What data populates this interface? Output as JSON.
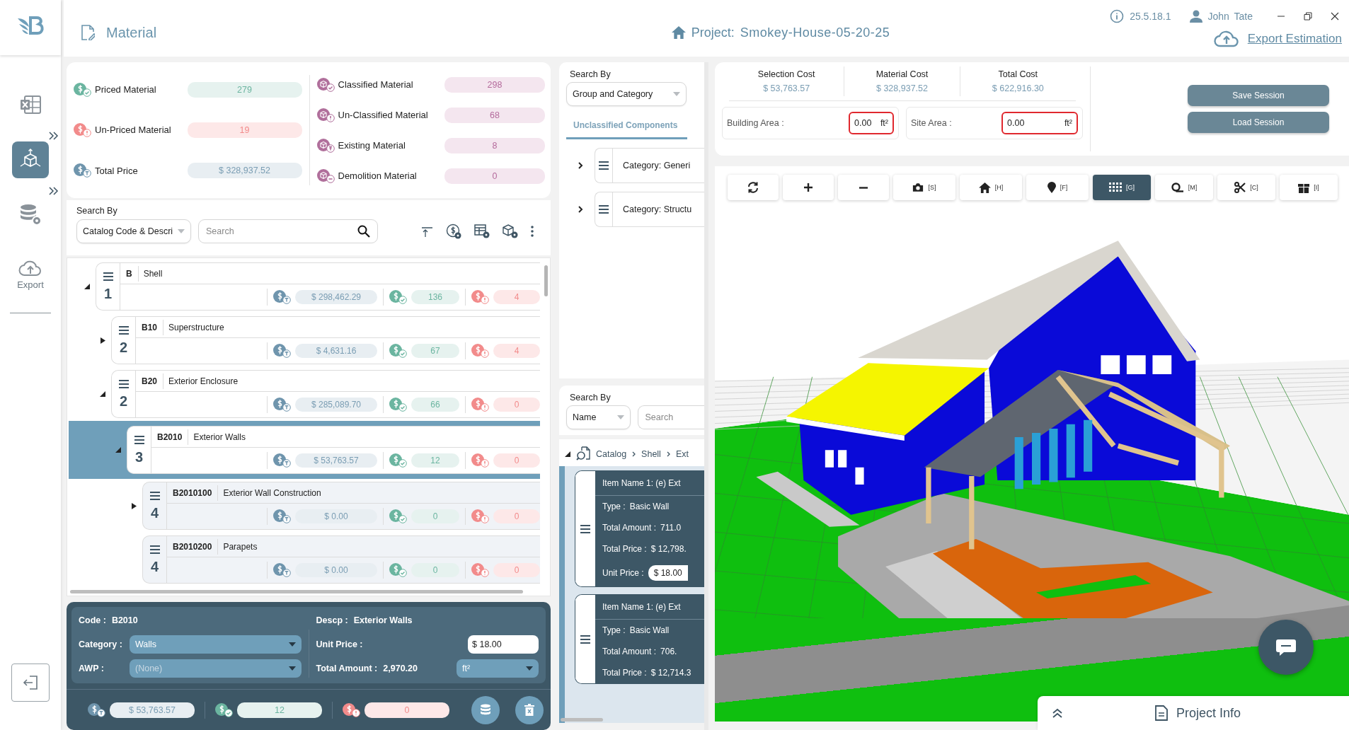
{
  "sidebar": {
    "items": [
      {
        "kind": "spreadsheet",
        "selected": false,
        "has_submenu": false
      },
      {
        "kind": "model",
        "selected": true,
        "has_submenu": true
      },
      {
        "kind": "database",
        "selected": false,
        "has_submenu": true
      },
      {
        "kind": "export",
        "selected": false,
        "has_submenu": false,
        "label": "Export"
      },
      {
        "kind": "logout",
        "selected": false,
        "has_submenu": false
      }
    ]
  },
  "header": {
    "title": "Material",
    "project_label": "Project:",
    "project_name": "Smokey-House-05-20-25",
    "version": "25.5.18.1",
    "user": "John Tate",
    "export": "Export Estimation"
  },
  "summary": {
    "left": [
      {
        "kind": "priced",
        "label": "Priced Material",
        "value": "279"
      },
      {
        "kind": "unpriced",
        "label": "Un-Priced Material",
        "value": "19"
      },
      {
        "kind": "total",
        "label": "Total Price",
        "value": "$ 328,937.52"
      }
    ],
    "right": [
      {
        "kind": "classified",
        "label": "Classified Material",
        "value": "298"
      },
      {
        "kind": "unclassified",
        "label": "Un-Classified Material",
        "value": "68"
      },
      {
        "kind": "existing",
        "label": "Existing Material",
        "value": "8"
      },
      {
        "kind": "demolition",
        "label": "Demolition Material",
        "value": "0"
      }
    ]
  },
  "search": {
    "label": "Search By",
    "by": "Catalog Code & Descri",
    "placeholder": "Search"
  },
  "tree": [
    {
      "code": "B",
      "name": "Shell",
      "level": "1",
      "expanded": true,
      "selected": false,
      "total": "$ 298,462.29",
      "priced": "136",
      "unpriced": "4",
      "children": [
        {
          "code": "B10",
          "name": "Superstructure",
          "level": "2",
          "expanded": false,
          "selected": false,
          "total": "$ 4,631.16",
          "priced": "67",
          "unpriced": "4"
        },
        {
          "code": "B20",
          "name": "Exterior Enclosure",
          "level": "2",
          "expanded": true,
          "selected": false,
          "total": "$ 285,089.70",
          "priced": "66",
          "unpriced": "0",
          "children": [
            {
              "code": "B2010",
              "name": "Exterior Walls",
              "level": "3",
              "expanded": true,
              "selected": true,
              "total": "$ 53,763.57",
              "priced": "12",
              "unpriced": "0",
              "children": [
                {
                  "code": "B2010100",
                  "name": "Exterior Wall Construction",
                  "level": "4",
                  "expanded": false,
                  "selected": false,
                  "total": "$ 0.00",
                  "priced": "0",
                  "unpriced": "0"
                },
                {
                  "code": "B2010200",
                  "name": "Parapets",
                  "level": "4",
                  "selected": false,
                  "total": "$ 0.00",
                  "priced": "0",
                  "unpriced": "0"
                }
              ]
            }
          ]
        }
      ]
    }
  ],
  "detail": {
    "code_label": "Code :",
    "code": "B2010",
    "descp_label": "Descp :",
    "descp": "Exterior Walls",
    "category_label": "Category :",
    "category": "Walls",
    "awp_label": "AWP :",
    "awp": "(None)",
    "unit_price_label": "Unit Price :",
    "unit_price": "$ 18.00",
    "total_amount_label": "Total Amount :",
    "total_amount": "2,970.20",
    "unit": "ft²",
    "total": "$ 53,763.57",
    "priced": "12",
    "unpriced": "0"
  },
  "middle": {
    "search_label": "Search By",
    "search_by": "Group and Category",
    "tab": {
      "label": "Unclassified Components",
      "selected": true
    },
    "categories": [
      {
        "label": "Category:",
        "value": "Generi"
      },
      {
        "label": "Category:",
        "value": "Structu"
      }
    ],
    "lower": {
      "search_label": "Search By",
      "search_by": "Name",
      "placeholder": "Search",
      "breadcrumb": [
        "Catalog",
        "Shell",
        "Ext"
      ],
      "items": [
        {
          "name": "Item Name 1: (e) Ext",
          "fields": [
            {
              "kind": "text",
              "label": "Type :",
              "value": "Basic Wall"
            },
            {
              "kind": "text",
              "label": "Total Amount :",
              "value": "711.0"
            },
            {
              "kind": "text",
              "label": "Total Price :",
              "value": "$ 12,798."
            },
            {
              "kind": "input",
              "label": "Unit Price :",
              "value": "$ 18.00"
            }
          ]
        },
        {
          "name": "Item Name 1: (e) Ext",
          "fields": [
            {
              "kind": "text",
              "label": "Type :",
              "value": "Basic Wall"
            },
            {
              "kind": "text",
              "label": "Total Amount :",
              "value": "706."
            },
            {
              "kind": "text",
              "label": "Total Price :",
              "value": "$ 12,714.3"
            }
          ]
        }
      ]
    }
  },
  "costs": [
    {
      "label": "Selection Cost",
      "value": "$ 53,763.57"
    },
    {
      "label": "Material Cost",
      "value": "$ 328,937.52"
    },
    {
      "label": "Total Cost",
      "value": "$ 622,916.30"
    }
  ],
  "areas": [
    {
      "label": "Building Area :",
      "value": "0.00",
      "unit": "ft²"
    },
    {
      "label": "Site Area :",
      "value": "0.00",
      "unit": "ft²"
    }
  ],
  "session_buttons": [
    "Save Session",
    "Load Session"
  ],
  "viewer": {
    "tools": [
      {
        "kind": "refresh",
        "selected": false
      },
      {
        "kind": "zoom-in",
        "selected": false
      },
      {
        "kind": "zoom-out",
        "selected": false
      },
      {
        "kind": "camera",
        "key": "[S]",
        "selected": false
      },
      {
        "kind": "home",
        "key": "[H]",
        "selected": false
      },
      {
        "kind": "pin",
        "key": "[F]",
        "selected": false
      },
      {
        "kind": "grid",
        "key": "[G]",
        "selected": true
      },
      {
        "kind": "measure",
        "key": "[M]",
        "selected": false
      },
      {
        "kind": "cut",
        "key": "[C]",
        "selected": false
      },
      {
        "kind": "box",
        "key": "[I]",
        "selected": false
      }
    ]
  },
  "project_info": {
    "label": "Project Info"
  }
}
